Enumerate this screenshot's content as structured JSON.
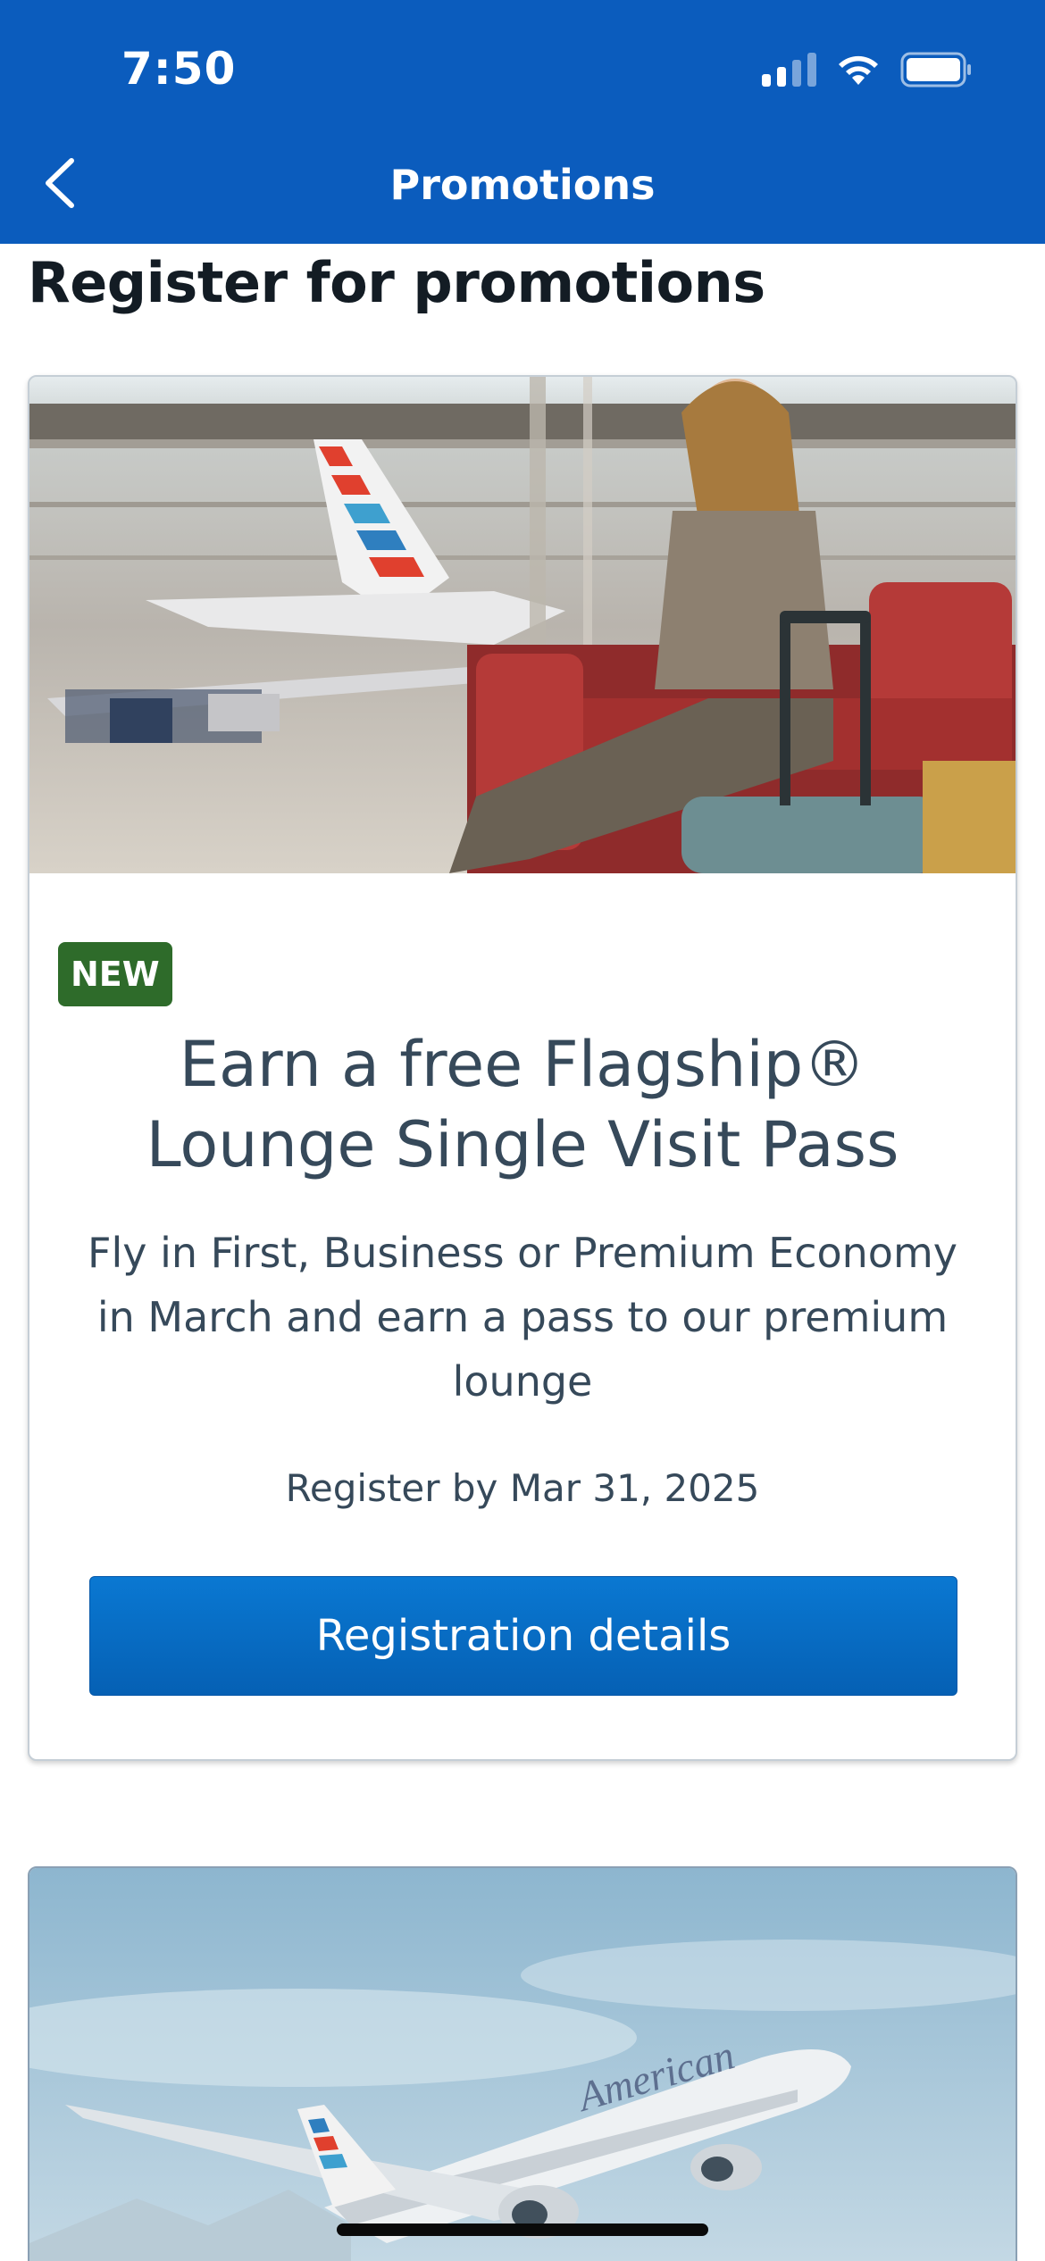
{
  "status_bar": {
    "time": "7:50"
  },
  "nav": {
    "title": "Promotions"
  },
  "page": {
    "title": "Register for promotions"
  },
  "promo_card": {
    "badge": "NEW",
    "title": "Earn a free Flagship® Lounge Single Visit Pass",
    "description": "Fly in First, Business or Premium Economy in March and earn a pass to our premium lounge",
    "deadline": "Register by Mar 31, 2025",
    "button_label": "Registration details"
  },
  "second_card": {
    "tail_text": "American"
  },
  "colors": {
    "header_bg": "#0b5cbd",
    "button_bg": "#0560b4",
    "badge_bg": "#2e6b2a",
    "body_text": "#36495a"
  }
}
